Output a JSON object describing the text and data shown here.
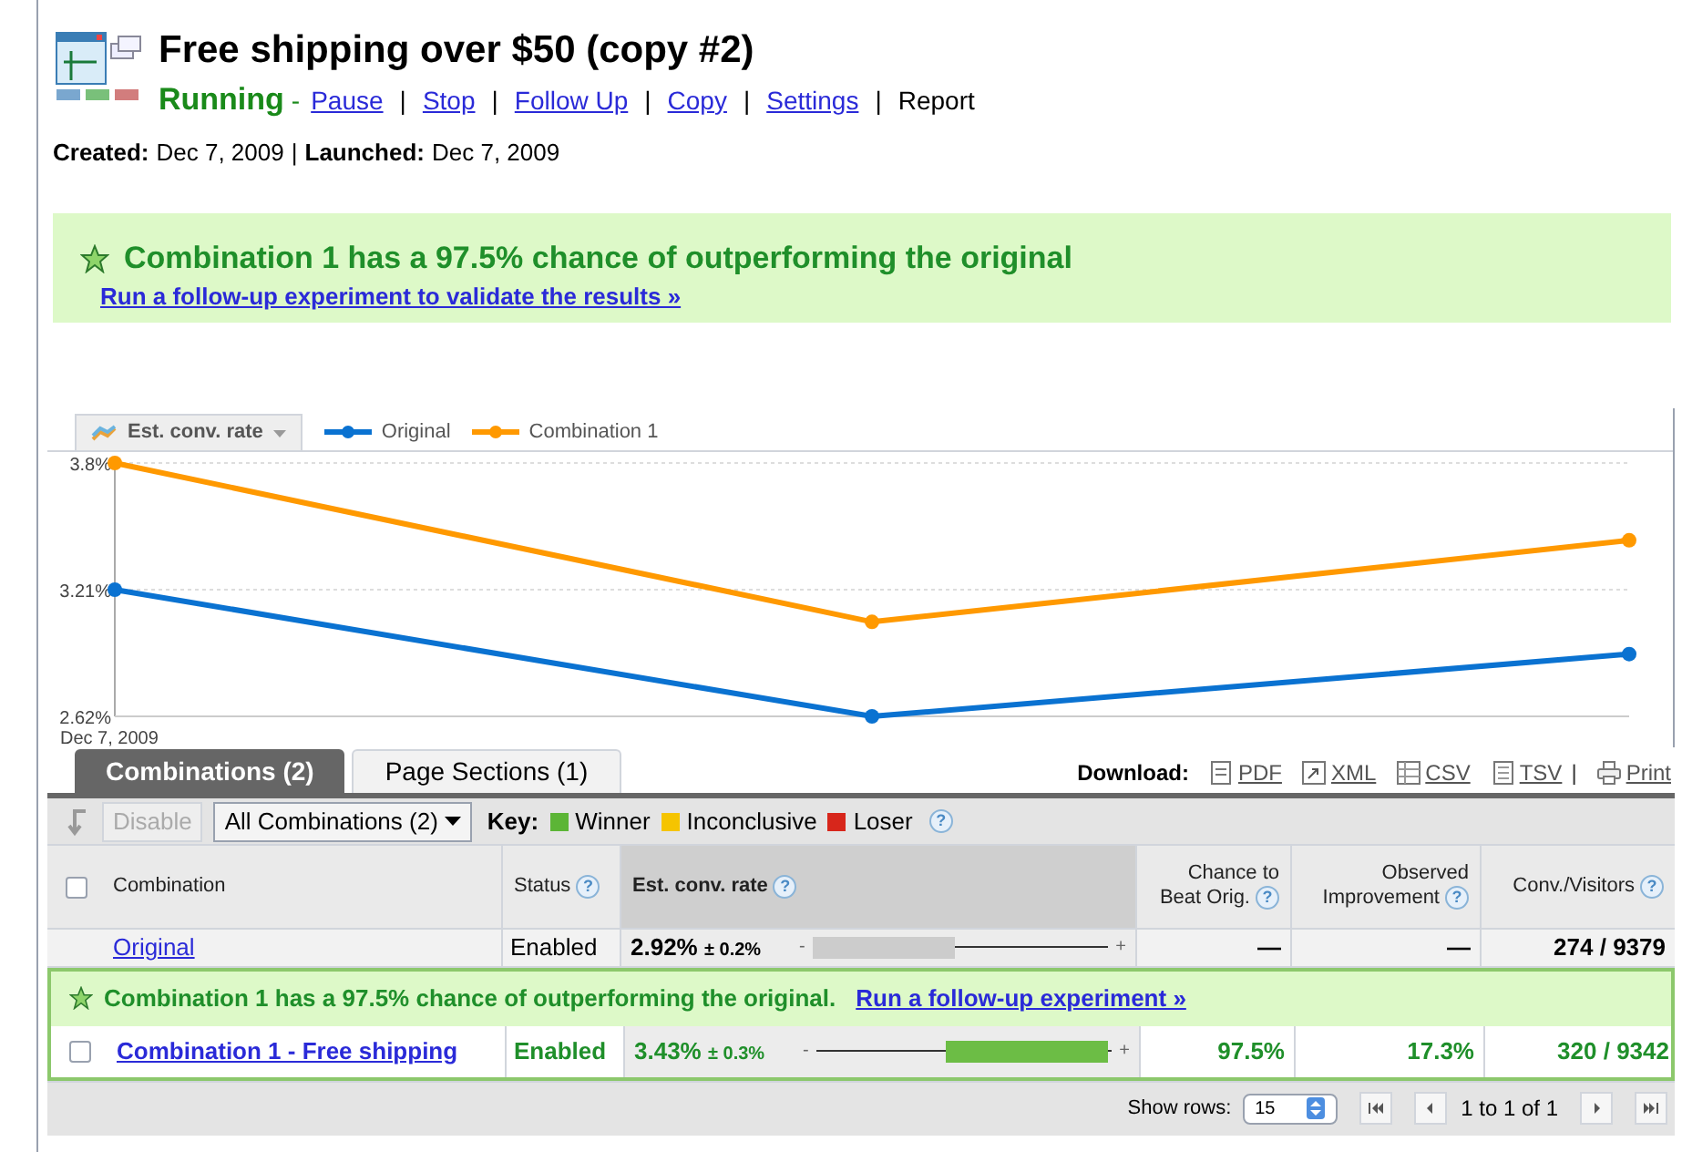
{
  "header": {
    "title": "Free shipping over $50 (copy #2)",
    "status": "Running",
    "separator": "-",
    "actions": [
      {
        "label": "Pause",
        "kind": "link"
      },
      {
        "label": "Stop",
        "kind": "link"
      },
      {
        "label": "Follow Up",
        "kind": "link"
      },
      {
        "label": "Copy",
        "kind": "link"
      },
      {
        "label": "Settings",
        "kind": "link"
      },
      {
        "label": "Report",
        "kind": "current"
      }
    ],
    "divider": "|",
    "created_label": "Created:",
    "created": "Dec 7, 2009",
    "launched_label": "Launched:",
    "launched": "Dec 7, 2009"
  },
  "banner": {
    "message": "Combination 1 has a 97.5% chance of outperforming the original",
    "link": "Run a follow-up experiment to validate the results »"
  },
  "chart": {
    "metric_dropdown": "Est. conv. rate",
    "chart_data": {
      "type": "line",
      "categories": [
        "Dec 7, 2009",
        null,
        null
      ],
      "ylim": [
        2.62,
        3.8
      ],
      "yticks": [
        {
          "value": 2.62,
          "label": "2.62%"
        },
        {
          "value": 3.21,
          "label": "3.21%"
        },
        {
          "value": 3.8,
          "label": "3.8%"
        }
      ],
      "series": [
        {
          "name": "Original",
          "color": "#0a72d1",
          "marker": "circle",
          "values": [
            3.21,
            2.62,
            2.91
          ]
        },
        {
          "name": "Combination 1",
          "color": "#ff9900",
          "marker": "circle",
          "values": [
            3.8,
            3.06,
            3.44
          ]
        }
      ]
    }
  },
  "tabs": [
    {
      "label": "Combinations (2)",
      "selected": true
    },
    {
      "label": "Page Sections (1)",
      "selected": false
    }
  ],
  "download": {
    "label": "Download:",
    "separator": "|",
    "formats": [
      {
        "label": "PDF",
        "kind": "pdf"
      },
      {
        "label": "XML",
        "kind": "xml"
      },
      {
        "label": "CSV",
        "kind": "csv"
      },
      {
        "label": "TSV",
        "kind": "tsv"
      },
      {
        "label": "Print",
        "kind": "print"
      }
    ]
  },
  "toolbar": {
    "disable_button": {
      "label": "Disable",
      "disabled": true
    },
    "filter": "All Combinations (2)",
    "key_label": "Key:",
    "key": [
      {
        "label": "Winner",
        "color": "#5cb536"
      },
      {
        "label": "Inconclusive",
        "color": "#f5c400"
      },
      {
        "label": "Loser",
        "color": "#d7261b"
      }
    ],
    "key_help": "?"
  },
  "table": {
    "select_all": {
      "checked": false
    },
    "columns": [
      {
        "label": "Combination"
      },
      {
        "label": "Status",
        "help": "?"
      },
      {
        "label": "Est. conv. rate",
        "help": "?",
        "sorted": true
      },
      {
        "label": "Chance to Beat Orig.",
        "help": "?"
      },
      {
        "label": "Observed Improvement",
        "help": "?"
      },
      {
        "label": "Conv./Visitors",
        "help": "?"
      }
    ],
    "rows": [
      {
        "kind": "baseline",
        "name": "Original",
        "status": "Enabled",
        "rate": "2.92%",
        "margin": "± 0.2%",
        "minus": "-",
        "plus": "+",
        "level": 0.48,
        "chance": "—",
        "improvement": "—",
        "conversions": "274 / 9379"
      },
      {
        "kind": "message",
        "message": "Combination 1 has a 97.5% chance of outperforming the original.",
        "link": "Run a follow-up experiment »"
      },
      {
        "kind": "winner",
        "checked": false,
        "name": "Combination 1 - Free shipping",
        "status": "Enabled",
        "rate": "3.43%",
        "margin": "± 0.3%",
        "minus": "-",
        "plus": "+",
        "level": 0.55,
        "chance": "97.5%",
        "improvement": "17.3%",
        "conversions": "320 / 9342"
      }
    ]
  },
  "footer": {
    "show_rows_label": "Show rows:",
    "show_rows": "15",
    "range": "1 to 1 of 1"
  }
}
